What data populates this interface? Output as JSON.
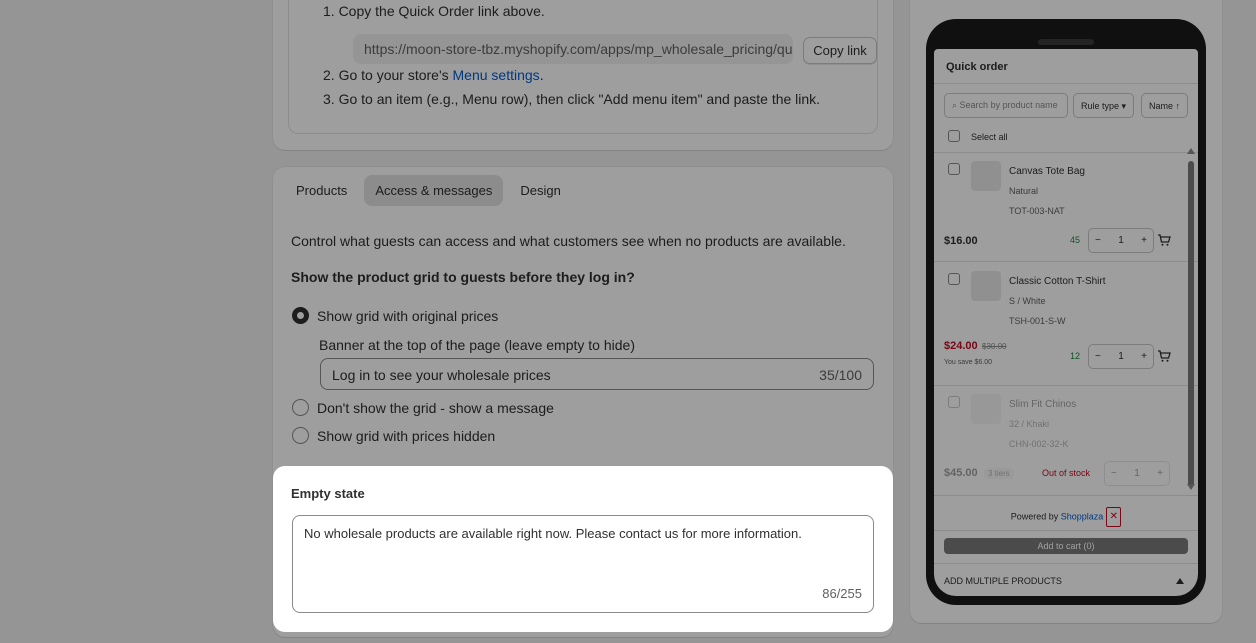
{
  "quick_link": {
    "step1": "1. Copy the Quick Order link above.",
    "url": "https://moon-store-tbz.myshopify.com/apps/mp_wholesale_pricing/quick-order",
    "copy_label": "Copy link",
    "step2_prefix": "2. Go to your store's ",
    "step2_link": "Menu settings",
    "step2_suffix": ".",
    "step3": "3. Go to an item (e.g., Menu row), then click \"Add menu item\" and paste the link."
  },
  "tabs": [
    {
      "label": "Products",
      "active": false
    },
    {
      "label": "Access & messages",
      "active": true
    },
    {
      "label": "Design",
      "active": false
    }
  ],
  "access": {
    "description": "Control what guests can access and what customers see when no products are available.",
    "question": "Show the product grid to guests before they log in?",
    "options": [
      {
        "label": "Show grid with original prices",
        "checked": true
      },
      {
        "label": "Don't show the grid - show a message",
        "checked": false
      },
      {
        "label": "Show grid with prices hidden",
        "checked": false
      }
    ],
    "banner_label": "Banner at the top of the page (leave empty to hide)",
    "banner_value": "Log in to see your wholesale prices",
    "banner_count": "35/100"
  },
  "empty_state": {
    "title": "Empty state",
    "value": "No wholesale products are available right now. Please contact us for more information.",
    "count": "86/255"
  },
  "preview": {
    "title": "Quick order",
    "search_placeholder": "Search by product name",
    "rule_type": "Rule type",
    "sort": "Name ↑",
    "select_all": "Select all",
    "products": [
      {
        "name": "Canvas Tote Bag",
        "variant": "Natural",
        "sku": "TOT-003-NAT",
        "price": "$16.00",
        "stock": "45",
        "qty": "1"
      },
      {
        "name": "Classic Cotton T-Shirt",
        "variant": "S / White",
        "sku": "TSH-001-S-W",
        "price": "$24.00",
        "compare": "$30.00",
        "save": "You save $6.00",
        "stock": "12",
        "qty": "1"
      },
      {
        "name": "Slim Fit Chinos",
        "variant": "32 / Khaki",
        "sku": "CHN-002-32-K",
        "price": "$45.00",
        "tiers": "3 tiers",
        "status": "Out of stock",
        "qty": "1"
      }
    ],
    "powered_prefix": "Powered by",
    "powered_brand": "Shopplaza",
    "add_to_cart": "Add to cart (0)",
    "add_multiple": "ADD MULTIPLE PRODUCTS",
    "colors": {
      "sale": "#c70a24",
      "stock": "#1a8a3c",
      "link": "#005bd3"
    }
  }
}
